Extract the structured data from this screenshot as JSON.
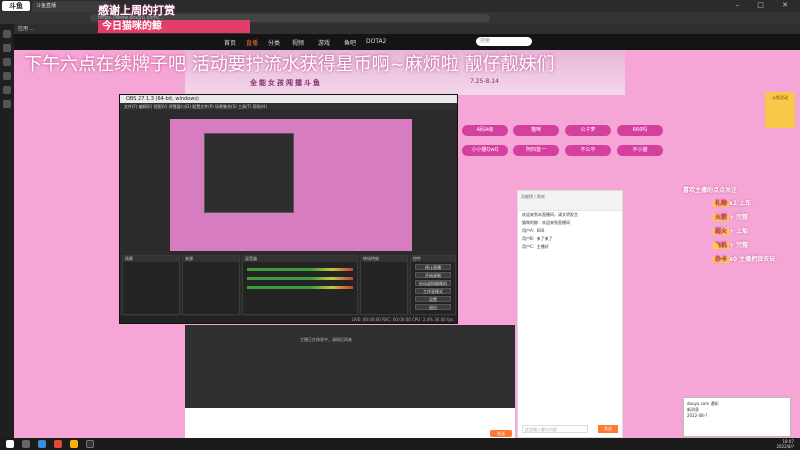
{
  "browser": {
    "logo": "斗鱼",
    "tab_title": "斗鱼直播",
    "window_controls": "– □ ✕",
    "address": "https://www.douyu.com/...",
    "bookmarks": "应用 ..."
  },
  "overlay": {
    "top_text": "感谢上周的打赏",
    "red_box": "今日猫咪的鲸",
    "marquee": "下午六点在续牌子吧 活动要拧流水获得星币啊~麻烦啦 靓仔靓妹们"
  },
  "nav": {
    "items": [
      "首页",
      "直播",
      "分类",
      "视频",
      "游戏",
      "鱼吧",
      "DOTA2"
    ],
    "search_placeholder": "搜索"
  },
  "banner": {
    "title": "全能女孩闯擂斗鱼",
    "date": "7.25-8.14"
  },
  "pills": [
    "A码A级",
    "猫咪",
    "公子萝",
    "666吗",
    "小小猫QwQ",
    "阿四首一",
    "不公平",
    "不小猫"
  ],
  "obs": {
    "title": "OBS 27.1.3 (64-bit, windows)",
    "menu": "文件(F) 编辑(E) 视图(V) 停靠窗口(D) 配置文件(P) 场景集合(S) 工具(T) 帮助(H)",
    "panels": {
      "scenes": "场景",
      "sources": "来源",
      "mixer": "混音器",
      "transitions": "转场特效",
      "controls": "控件"
    },
    "buttons": [
      "停止直播",
      "开始录制",
      "启动虚拟摄像机",
      "工作室模式",
      "设置",
      "退出"
    ],
    "status": "LIVE: 00:00:00  REC: 00:00:00  CPU: 2.4%  30.00 fps"
  },
  "player": {
    "text": "主播正在休息中，请稍后再来",
    "send_label": "发送"
  },
  "chat": {
    "header": "贡献榜 / 贵宾",
    "messages": [
      "欢迎来到本直播间，请文明发言",
      "猫咪的鲸：欢迎来到直播间",
      "用户A：666",
      "用户B：来了来了",
      "用户C：主播好"
    ],
    "input_placeholder": "这里输入聊天内容",
    "send_label": "发送"
  },
  "notice": {
    "title": "喜欢主播的点点关注",
    "rows": [
      {
        "tag": "礼物",
        "text": "x2 上车"
      },
      {
        "tag": "火箭",
        "text": "+ 完整"
      },
      {
        "tag": "超火",
        "text": "+ 上船"
      },
      {
        "tag": "飞机",
        "text": "+ 完整"
      },
      {
        "tag": "办卡",
        "text": "x0 主播把我去玩"
      }
    ]
  },
  "popup": {
    "title": "douyu.com 通知",
    "body": "新消息",
    "time": "2022-08-?"
  },
  "ad": {
    "text": "斗鱼活动"
  },
  "taskbar": {
    "time": "18:07",
    "date": "2022/8/?"
  }
}
